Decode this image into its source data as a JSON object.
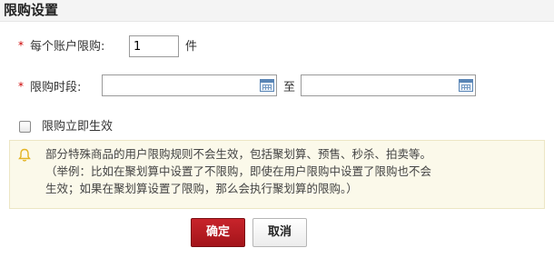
{
  "dialog": {
    "title": "限购设置"
  },
  "form": {
    "limit_per_account": {
      "label": "每个账户限购:",
      "value": "1",
      "unit": "件"
    },
    "period": {
      "label": "限购时段:",
      "start_value": "",
      "separator": "至",
      "end_value": ""
    },
    "immediate": {
      "label": "限购立即生效",
      "checked": false
    },
    "required_mark": "*"
  },
  "notice": {
    "line1": "部分特殊商品的用户限购规则不会生效，包括聚划算、预售、秒杀、拍卖等。",
    "line2": "（举例：比如在聚划算中设置了不限购，即使在用户限购中设置了限购也不会",
    "line3": "生效；如果在聚划算设置了限购，那么会执行聚划算的限购。）",
    "icon": "bell-icon"
  },
  "buttons": {
    "confirm": "确定",
    "cancel": "取消"
  },
  "colors": {
    "primary": "#b51b21",
    "required": "#cc0000",
    "notice_bg": "#fbf9ea",
    "icon_blue": "#5a86b6",
    "bell": "#e3b321"
  }
}
